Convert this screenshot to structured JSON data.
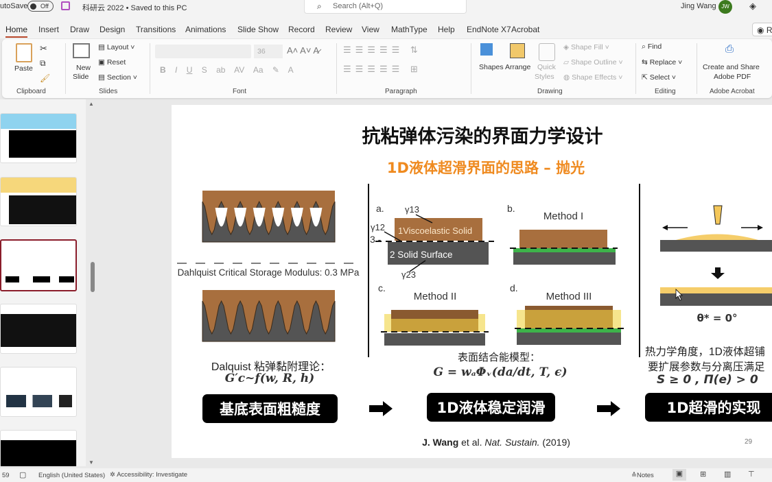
{
  "titlebar": {
    "autosave": "utoSave",
    "toggle": "Off",
    "doc_title": "科研云 2022 • Saved to this PC",
    "search_placeholder": "Search (Alt+Q)",
    "user": "Jing Wang",
    "avatar": "JW"
  },
  "tabs": [
    "Home",
    "Insert",
    "Draw",
    "Design",
    "Transitions",
    "Animations",
    "Slide Show",
    "Record",
    "Review",
    "View",
    "MathType",
    "Help",
    "EndNote X7",
    "Acrobat"
  ],
  "record_btn": "R",
  "ribbon": {
    "clipboard": {
      "paste": "Paste",
      "group": "Clipboard"
    },
    "slides": {
      "new_slide": "New",
      "new_slide2": "Slide",
      "layout": "Layout",
      "reset": "Reset",
      "section": "Section",
      "group": "Slides"
    },
    "font": {
      "size": "36",
      "group": "Font",
      "bold": "B",
      "italic": "I",
      "underline": "U",
      "strike": "S",
      "case": "Aa"
    },
    "paragraph": {
      "group": "Paragraph"
    },
    "drawing": {
      "shapes": "Shapes",
      "arrange": "Arrange",
      "quick": "Quick",
      "styles": "Styles",
      "fill": "Shape Fill",
      "outline": "Shape Outline",
      "effects": "Shape Effects",
      "group": "Drawing"
    },
    "editing": {
      "find": "Find",
      "replace": "Replace",
      "select": "Select",
      "group": "Editing"
    },
    "acrobat": {
      "create": "Create and Share",
      "pdf": "Adobe PDF",
      "group": "Adobe Acrobat"
    }
  },
  "slide": {
    "title": "抗粘弹体污染的界面力学设计",
    "subtitle": "1D液体超滑界面的思路 – 抛光",
    "left": {
      "critical": "Dahlquist Critical Storage Modulus: 0.3 MPa",
      "theory": "Dalquist 粘弹黏附理论：",
      "formula": "G′c~f(w, R, h)"
    },
    "middle": {
      "a": "a.",
      "b": "b.",
      "c": "c.",
      "d": "d.",
      "g13": "γ13",
      "g12": "γ12",
      "g23": "γ23",
      "three": "3 -",
      "visco": "1Viscoelastic Solid",
      "solid": "2  Solid Surface",
      "m1": "Method I",
      "m2": "Method II",
      "m3": "Method III",
      "model": "表面结合能模型：",
      "formula": "G = wₐΦᵥ(da/dt, T, ϵ)"
    },
    "right": {
      "theta": "θ* = 0°",
      "line1": "热力学角度，1D液体超铺",
      "line2": "要扩展参数与分离压满足",
      "line3": "S ≥ 0 , Π(e) > 0"
    },
    "buttons": [
      "基底表面粗糙度",
      "1D液体稳定润滑",
      "1D超滑的实现"
    ],
    "citation": {
      "author": "J. Wang",
      "rest": " et al. ",
      "journal": "Nat. Sustain.",
      "year": " (2019)"
    },
    "page_number": "29",
    "colors": {
      "subtitle": "#ef8a1f",
      "brown": "#a86f3e",
      "gray": "#545454",
      "green": "#3db34a",
      "gold": "#c9a13c",
      "pale": "#f6e58d"
    }
  },
  "status": {
    "slide": "59",
    "language": "English (United States)",
    "accessibility": "Accessibility: Investigate",
    "notes": "Notes"
  }
}
